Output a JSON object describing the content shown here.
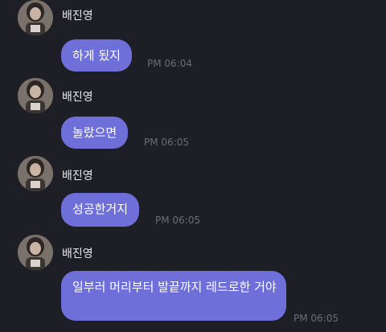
{
  "messages": [
    {
      "sender": "배진영",
      "text": "하게 됬지",
      "time": "PM 06:04"
    },
    {
      "sender": "배진영",
      "text": "놀랐으면",
      "time": "PM 06:05"
    },
    {
      "sender": "배진영",
      "text": "성공한거지",
      "time": "PM 06:05"
    },
    {
      "sender": "배진영",
      "text": "일부러 머리부터 발끝까지 레드로한 거야",
      "time": "PM 06:05"
    }
  ],
  "colors": {
    "background": "#1e1e26",
    "bubble": "#6f6fd9",
    "time": "#6d6d78",
    "sender": "#e8e8ec"
  },
  "icons": {
    "avatar": "profile-photo-avatar"
  }
}
